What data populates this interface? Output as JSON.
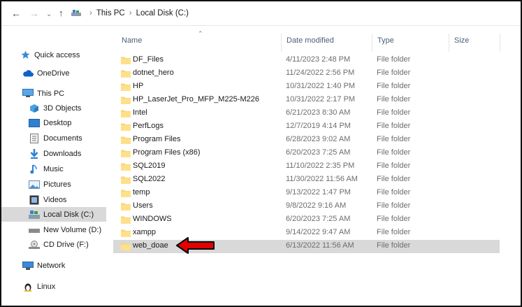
{
  "address": {
    "breadcrumbs": [
      "This PC",
      "Local Disk (C:)"
    ]
  },
  "columns": {
    "name": "Name",
    "date": "Date modified",
    "type": "Type",
    "size": "Size"
  },
  "sidebar": [
    {
      "label": "Quick access",
      "icon": "star-icon"
    },
    {
      "label": "OneDrive",
      "icon": "cloud-icon"
    },
    {
      "label": "This PC",
      "icon": "computer-icon"
    },
    {
      "label": "3D Objects",
      "icon": "cube-icon"
    },
    {
      "label": "Desktop",
      "icon": "desktop-icon"
    },
    {
      "label": "Documents",
      "icon": "document-icon"
    },
    {
      "label": "Downloads",
      "icon": "download-icon"
    },
    {
      "label": "Music",
      "icon": "music-icon"
    },
    {
      "label": "Pictures",
      "icon": "pictures-icon"
    },
    {
      "label": "Videos",
      "icon": "videos-icon"
    },
    {
      "label": "Local Disk (C:)",
      "icon": "drive-icon",
      "selected": true
    },
    {
      "label": "New Volume (D:)",
      "icon": "drive-icon"
    },
    {
      "label": "CD Drive (F:)",
      "icon": "cd-drive-icon"
    },
    {
      "label": "Network",
      "icon": "network-icon"
    },
    {
      "label": "Linux",
      "icon": "linux-icon"
    }
  ],
  "files": [
    {
      "name": "DF_Files",
      "date": "4/11/2023 2:48 PM",
      "type": "File folder"
    },
    {
      "name": "dotnet_hero",
      "date": "11/24/2022 2:56 PM",
      "type": "File folder"
    },
    {
      "name": "HP",
      "date": "10/31/2022 1:40 PM",
      "type": "File folder"
    },
    {
      "name": "HP_LaserJet_Pro_MFP_M225-M226",
      "date": "10/31/2022 2:17 PM",
      "type": "File folder"
    },
    {
      "name": "Intel",
      "date": "6/21/2023 8:30 AM",
      "type": "File folder"
    },
    {
      "name": "PerfLogs",
      "date": "12/7/2019 4:14 PM",
      "type": "File folder"
    },
    {
      "name": "Program Files",
      "date": "6/28/2023 9:02 AM",
      "type": "File folder"
    },
    {
      "name": "Program Files (x86)",
      "date": "6/20/2023 7:25 AM",
      "type": "File folder"
    },
    {
      "name": "SQL2019",
      "date": "11/10/2022 2:35 PM",
      "type": "File folder"
    },
    {
      "name": "SQL2022",
      "date": "11/30/2022 11:56 AM",
      "type": "File folder"
    },
    {
      "name": "temp",
      "date": "9/13/2022 1:47 PM",
      "type": "File folder"
    },
    {
      "name": "Users",
      "date": "9/8/2022 9:16 AM",
      "type": "File folder"
    },
    {
      "name": "WINDOWS",
      "date": "6/20/2023 7:25 AM",
      "type": "File folder"
    },
    {
      "name": "xampp",
      "date": "9/14/2022 9:47 AM",
      "type": "File folder"
    },
    {
      "name": "web_doae",
      "date": "6/13/2022 11:56 AM",
      "type": "File folder",
      "selected": true
    }
  ],
  "colors": {
    "selection": "#d9d9d9",
    "folder": "#f7d774",
    "arrow": "#e30000"
  }
}
